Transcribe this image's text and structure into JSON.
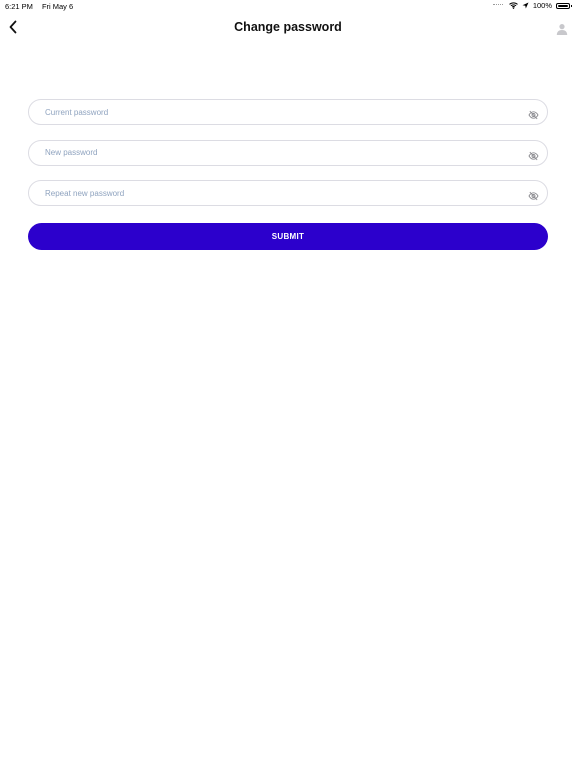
{
  "status_bar": {
    "time": "6:21 PM",
    "date": "Fri May 6",
    "battery_percent": "100%",
    "battery_level": 1.0
  },
  "header": {
    "title": "Change password",
    "back_icon": "chevron-left-icon",
    "avatar_icon": "user-avatar-icon"
  },
  "form": {
    "fields": [
      {
        "placeholder": "Current password",
        "value": "",
        "toggle_icon": "eye-off-icon"
      },
      {
        "placeholder": "New password",
        "value": "",
        "toggle_icon": "eye-off-icon"
      },
      {
        "placeholder": "Repeat new password",
        "value": "",
        "toggle_icon": "eye-off-icon"
      }
    ],
    "submit_label": "SUBMIT"
  },
  "colors": {
    "accent": "#2c00cc",
    "placeholder": "#8fa3bf",
    "field_border": "#dcdce3",
    "title": "#111111"
  }
}
